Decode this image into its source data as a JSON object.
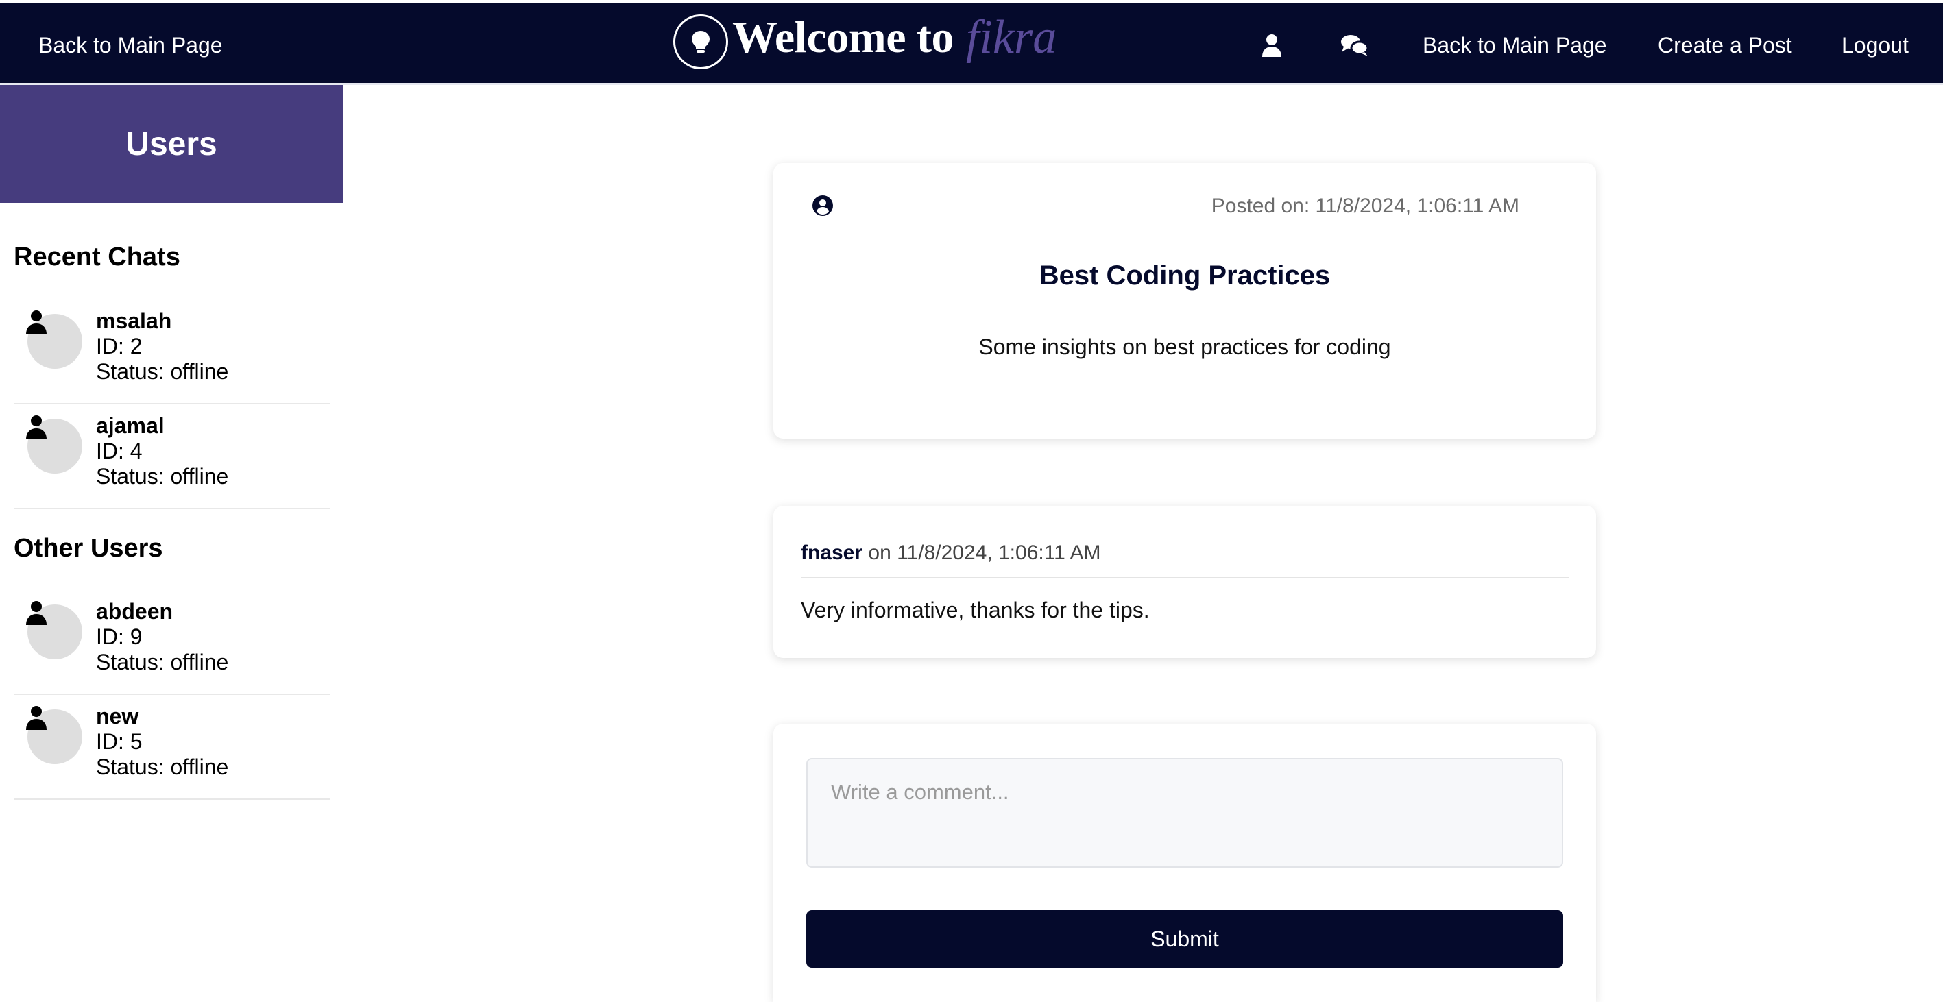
{
  "header": {
    "back_left": "Back to Main Page",
    "brand_welcome": "Welcome to",
    "brand_name": "fikra",
    "nav": {
      "back": "Back to Main Page",
      "create": "Create a Post",
      "logout": "Logout"
    },
    "icons": [
      "lightbulb-icon",
      "user-icon",
      "chat-icon"
    ]
  },
  "sidebar": {
    "title": "Users",
    "recent_title": "Recent Chats",
    "recent": [
      {
        "name": "msalah",
        "id": "ID: 2",
        "status": "Status: offline"
      },
      {
        "name": "ajamal",
        "id": "ID: 4",
        "status": "Status: offline"
      }
    ],
    "other_title": "Other Users",
    "others": [
      {
        "name": "abdeen",
        "id": "ID: 9",
        "status": "Status: offline"
      },
      {
        "name": "new",
        "id": "ID: 5",
        "status": "Status: offline"
      }
    ]
  },
  "post": {
    "posted_on": "Posted on: 11/8/2024, 1:06:11 AM",
    "title": "Best Coding Practices",
    "body": "Some insights on best practices for coding"
  },
  "comments": [
    {
      "author": "fnaser",
      "meta": "on 11/8/2024, 1:06:11 AM",
      "text": "Very informative, thanks for the tips."
    }
  ],
  "comment_form": {
    "placeholder": "Write a comment...",
    "submit_label": "Submit"
  },
  "colors": {
    "navy": "#050a2c",
    "purple": "#463c7e",
    "brand_accent": "#5a4c9a"
  }
}
